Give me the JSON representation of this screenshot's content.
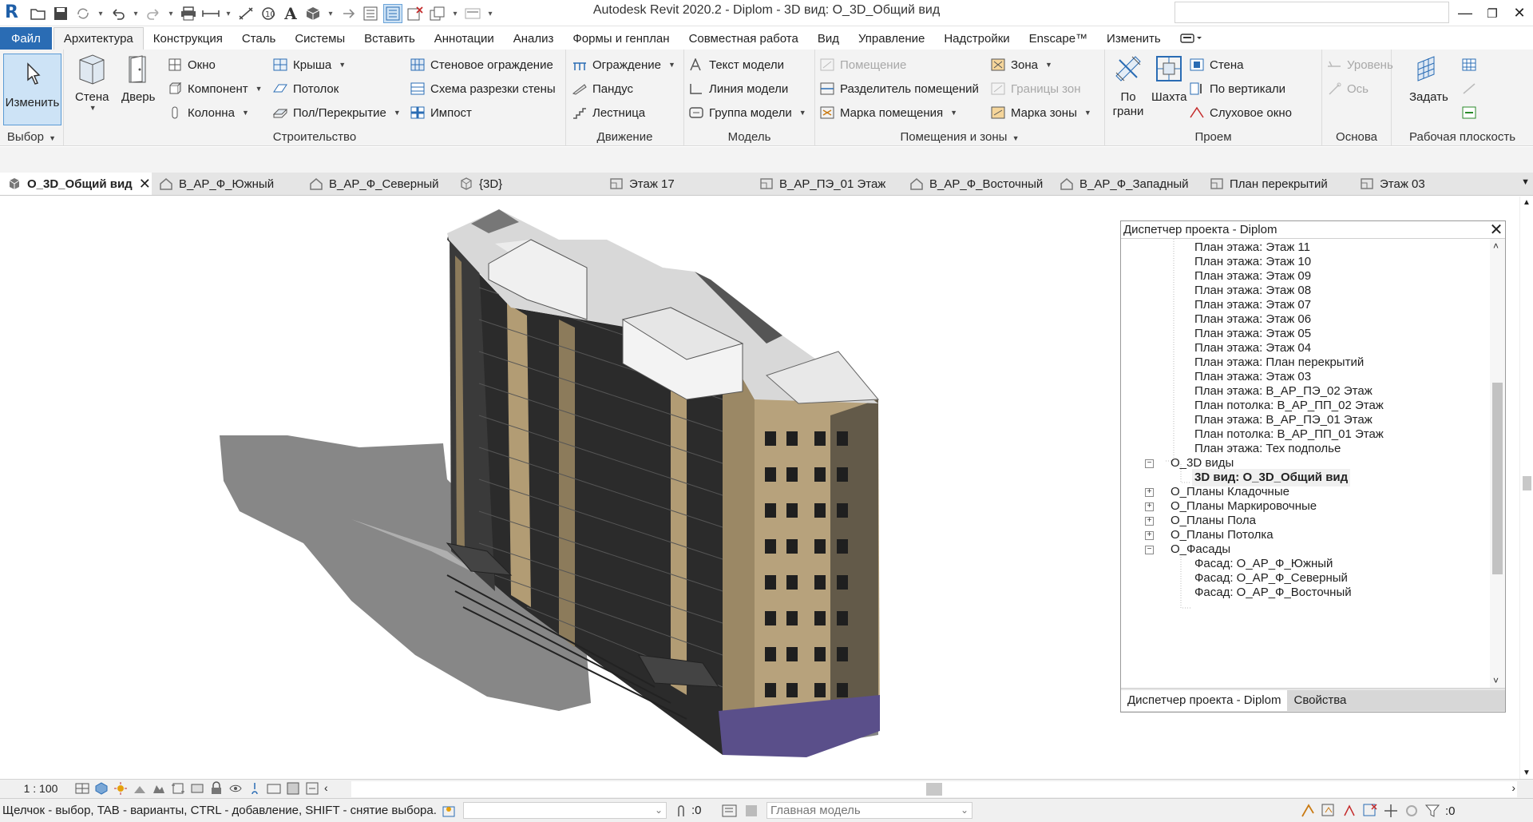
{
  "window": {
    "title": "Autodesk Revit 2020.2 - Diplom - 3D вид: О_3D_Общий вид",
    "minimize": "—",
    "maximize": "❐",
    "close": "✕"
  },
  "app_logo": "R",
  "ribbon_tabs": [
    "Файл",
    "Архитектура",
    "Конструкция",
    "Сталь",
    "Системы",
    "Вставить",
    "Аннотации",
    "Анализ",
    "Формы и генплан",
    "Совместная работа",
    "Вид",
    "Управление",
    "Надстройки",
    "Enscape™",
    "Изменить"
  ],
  "ribbon": {
    "modify": "Изменить",
    "select_panel": "Выбор",
    "wall": "Стена",
    "door": "Дверь",
    "window": "Окно",
    "component": "Компонент",
    "column": "Колонна",
    "roof": "Крыша",
    "ceiling": "Потолок",
    "floor": "Пол/Перекрытие",
    "curtain_system": "Стеновое ограждение",
    "curtain_grid": "Схема разрезки стены",
    "mullion": "Импост",
    "build_panel": "Строительство",
    "railing": "Ограждение",
    "ramp": "Пандус",
    "stair": "Лестница",
    "circulation_panel": "Движение",
    "model_text": "Текст модели",
    "model_line": "Линия  модели",
    "model_group": "Группа модели",
    "model_panel": "Модель",
    "room": "Помещение",
    "room_separator": "Разделитель помещений",
    "room_tag": "Марка помещения",
    "area": "Зона",
    "area_boundary": "Границы  зон",
    "area_tag": "Марка  зоны",
    "room_area_panel": "Помещения и зоны",
    "by_face": "По грани",
    "shaft": "Шахта",
    "opening_wall": "Стена",
    "vertical": "По вертикали",
    "dormer": "Слуховое окно",
    "opening_panel": "Проем",
    "level": "Уровень",
    "grid": "Ось",
    "datum_panel": "Основа",
    "set": "Задать",
    "workplane_panel": "Рабочая плоскость"
  },
  "view_tabs": [
    {
      "label": "О_3D_Общий вид",
      "icon": "3d-view-icon",
      "active": true
    },
    {
      "label": "В_АР_Ф_Южный",
      "icon": "elevation-icon"
    },
    {
      "label": "В_АР_Ф_Северный",
      "icon": "elevation-icon"
    },
    {
      "label": "{3D}",
      "icon": "3d-view-icon"
    },
    {
      "label": "Этаж 17",
      "icon": "floor-plan-icon"
    },
    {
      "label": "В_АР_ПЭ_01 Этаж",
      "icon": "floor-plan-icon"
    },
    {
      "label": "В_АР_Ф_Восточный",
      "icon": "elevation-icon"
    },
    {
      "label": "В_АР_Ф_Западный",
      "icon": "elevation-icon"
    },
    {
      "label": "План перекрытий",
      "icon": "floor-plan-icon"
    },
    {
      "label": "Этаж 03",
      "icon": "floor-plan-icon"
    }
  ],
  "browser": {
    "title": "Диспетчер проекта - Diplom",
    "items": [
      "План этажа: Этаж 11",
      "План этажа: Этаж 10",
      "План этажа: Этаж 09",
      "План этажа: Этаж 08",
      "План этажа: Этаж 07",
      "План этажа: Этаж 06",
      "План этажа: Этаж 05",
      "План этажа: Этаж 04",
      "План этажа: План перекрытий",
      "План этажа: Этаж 03",
      "План этажа: В_АР_ПЭ_02 Этаж",
      "План потолка: В_АР_ПП_02 Этаж",
      "План этажа: В_АР_ПЭ_01 Этаж",
      "План потолка: В_АР_ПП_01 Этаж",
      "План этажа: Тех подполье"
    ],
    "group_3d": "О_3D виды",
    "selected_view": "3D вид: О_3D_Общий вид",
    "groups": [
      "О_Планы Кладочные",
      "О_Планы Маркировочные",
      "О_Планы Пола",
      "О_Планы Потолка"
    ],
    "group_facades": "О_Фасады",
    "facades": [
      "Фасад: О_АР_Ф_Южный",
      "Фасад: О_АР_Ф_Северный",
      "Фасад: О_АР_Ф_Восточный"
    ],
    "tab_browser": "Диспетчер проекта - Diplom",
    "tab_properties": "Свойства"
  },
  "view_control": {
    "scale": "1 : 100"
  },
  "status": {
    "hint": "Щелчок - выбор, TAB - варианты, CTRL - добавление, SHIFT - снятие выбора.",
    "workset_count": ":0",
    "design_option": "Главная модель",
    "filter_count": ":0"
  },
  "colors": {
    "accent": "#2a6cb4",
    "facade": "#b7a27c",
    "facade_dark": "#2b2b2b",
    "shadow": "#8a8a8a",
    "base": "#5a4f8a"
  }
}
